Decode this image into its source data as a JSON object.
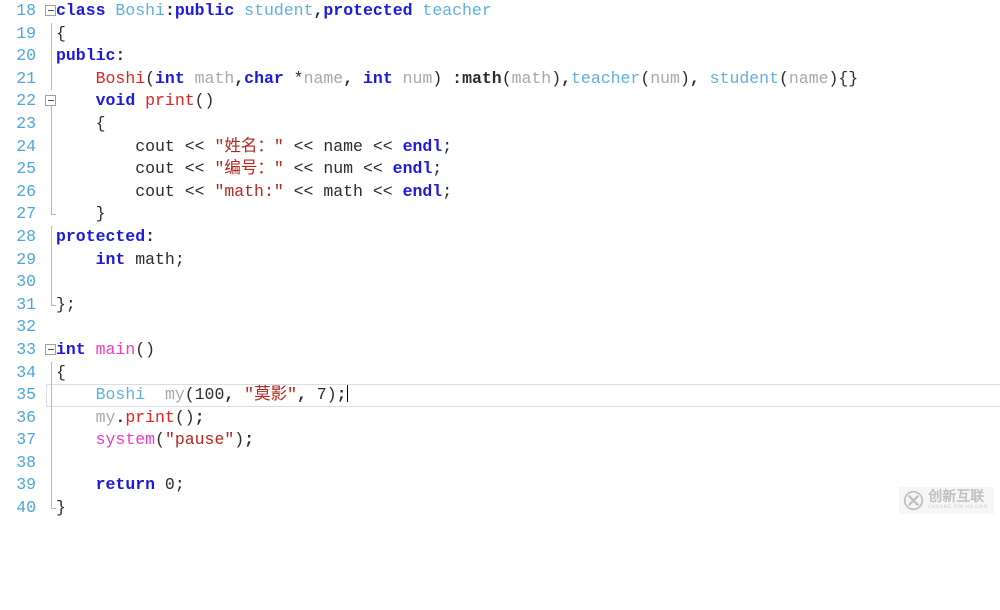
{
  "editor": {
    "language": "C++",
    "background_color": "#ffffff",
    "line_number_color": "#4ca6dd",
    "current_line": 35,
    "first_visible_line": 18,
    "last_visible_line": 40,
    "colors": {
      "keyword": "#1a1ae0",
      "user_type": "#5fb0e0",
      "function": "#e82020",
      "macro": "#ee3bc4",
      "string": "#b5261e",
      "identifier": "#a8a8a8",
      "plain": "#2b2b2b",
      "fold_guide": "#b9b9b9",
      "current_line_border": "#dcdce8"
    }
  },
  "lines": [
    {
      "n": "18",
      "fold": "open",
      "text": "class Boshi:public student,protected teacher"
    },
    {
      "n": "19",
      "fold": "guide",
      "text": "{"
    },
    {
      "n": "20",
      "fold": "guide",
      "text": "public:"
    },
    {
      "n": "21",
      "fold": "guide",
      "text": "    Boshi(int math,char *name, int num) :math(math),teacher(num), student(name){}"
    },
    {
      "n": "22",
      "fold": "open",
      "text": "    void print()"
    },
    {
      "n": "23",
      "fold": "guide",
      "text": "    {"
    },
    {
      "n": "24",
      "fold": "guide",
      "text": "        cout << \"姓名：\" << name << endl;"
    },
    {
      "n": "25",
      "fold": "guide",
      "text": "        cout << \"编号：\" << num << endl;"
    },
    {
      "n": "26",
      "fold": "guide",
      "text": "        cout << \"math:\" << math << endl;"
    },
    {
      "n": "27",
      "fold": "guide",
      "text": "    }"
    },
    {
      "n": "28",
      "fold": "guide",
      "text": "protected:"
    },
    {
      "n": "29",
      "fold": "guide",
      "text": "    int math;"
    },
    {
      "n": "30",
      "fold": "guide",
      "text": ""
    },
    {
      "n": "31",
      "fold": "end",
      "text": "};"
    },
    {
      "n": "32",
      "fold": "none",
      "text": ""
    },
    {
      "n": "33",
      "fold": "open",
      "text": "int main()"
    },
    {
      "n": "34",
      "fold": "guide",
      "text": "{"
    },
    {
      "n": "35",
      "fold": "guide",
      "text": "    Boshi  my(100, \"莫影\", 7);",
      "current": true,
      "caret": true
    },
    {
      "n": "36",
      "fold": "guide",
      "text": "    my.print();"
    },
    {
      "n": "37",
      "fold": "guide",
      "text": "    system(\"pause\");"
    },
    {
      "n": "38",
      "fold": "guide",
      "text": ""
    },
    {
      "n": "39",
      "fold": "guide",
      "text": "    return 0;"
    },
    {
      "n": "40",
      "fold": "end",
      "text": "}"
    }
  ],
  "watermark": {
    "logo_icon": "circle-x-logo-icon",
    "main_text": "创新互联",
    "sub_text": "CHUANG XIN HU LIAN"
  }
}
